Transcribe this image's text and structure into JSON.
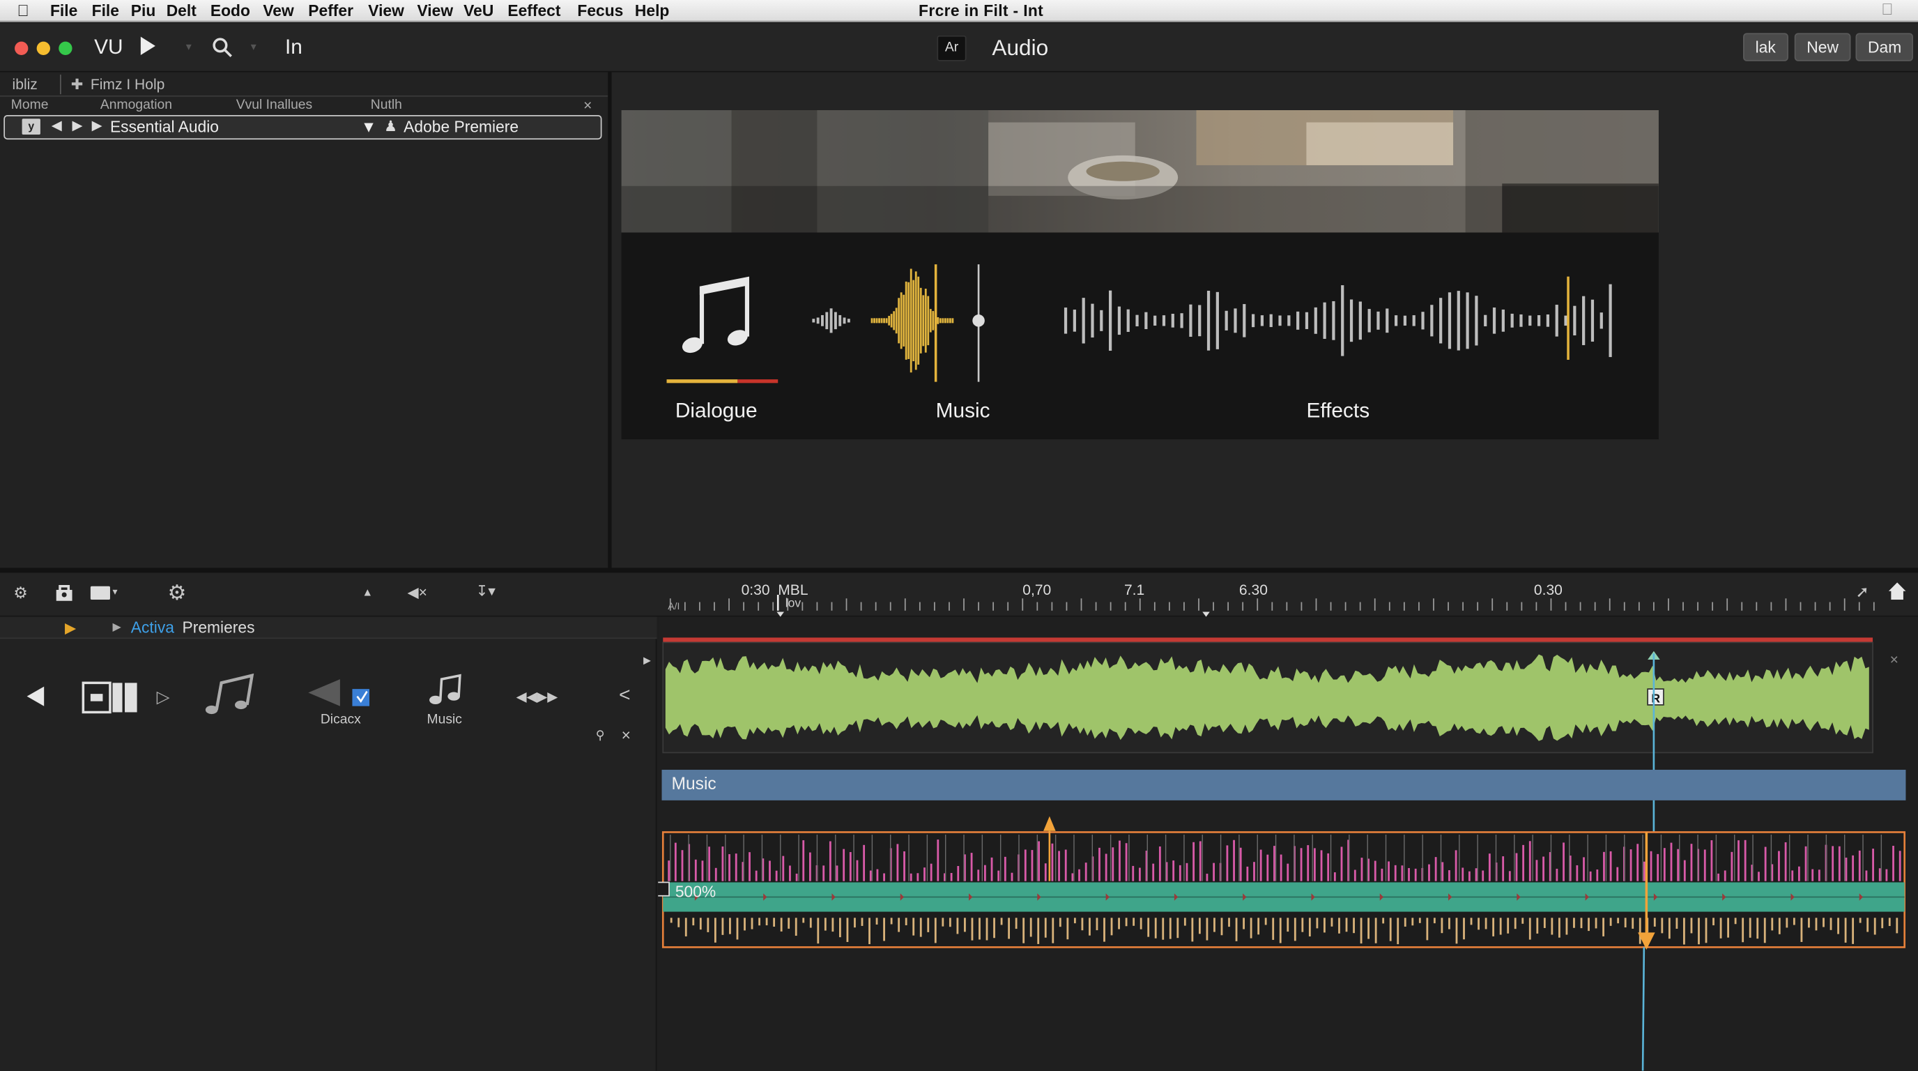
{
  "menubar": {
    "items": [
      "File",
      "File",
      "Piu",
      "Delt",
      "Eodo",
      "Vew",
      "Peffer",
      "View",
      "View",
      "VeU",
      "Eeffect",
      "Fecus",
      "Help"
    ],
    "title": "Frcre in Filt - Int"
  },
  "toolbar": {
    "app_label": "VU",
    "field_label": "In",
    "badge": "Ar",
    "workspace_title": "Audio",
    "buttons": [
      "lak",
      "New",
      "Dam"
    ],
    "traffic_colors": [
      "#f25c54",
      "#f6bd2f",
      "#35c84a"
    ]
  },
  "left_panel": {
    "tab1": "ibliz",
    "tab2": "Fimz I Holp",
    "columns": [
      "Mome",
      "Anmogation",
      "Vvul Inallues",
      "Nutlh"
    ],
    "row": {
      "label": "Essential Audio",
      "value": "Adobe Premiere"
    }
  },
  "monitor": {
    "categories": [
      "Dialogue",
      "Music",
      "Effects"
    ]
  },
  "timeline": {
    "ruler_labels": [
      "0:30",
      "MBL",
      "lov",
      "0,70",
      "7.1",
      "6.30",
      "0.30"
    ],
    "ruler_small": "A/I",
    "breadcrumb_active": "Activa",
    "breadcrumb_rest": "Premieres",
    "track_tools": [
      "Dicacx",
      "Music"
    ],
    "music_clip_label": "Music",
    "zoom_label": "500%",
    "colors": {
      "waveform": "#9fc46a",
      "music_bar": "#56789d",
      "teal": "#3fa58a",
      "orange": "#e6803a",
      "pink": "#d85aa8",
      "playhead": "#5ab4d8"
    }
  }
}
